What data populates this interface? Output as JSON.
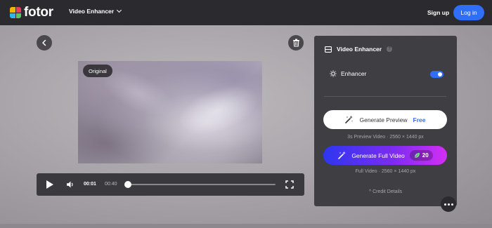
{
  "header": {
    "logo_text": "fotor",
    "product_menu_label": "Video Enhancer",
    "signup_label": "Sign up",
    "login_label": "Log in"
  },
  "player": {
    "badge": "Original",
    "current_time": "00:01",
    "total_time": "00:40",
    "progress": 0.0
  },
  "panel": {
    "title": "Video Enhancer",
    "help_glyph": "?",
    "enhancer_label": "Enhancer",
    "enhancer_on": true,
    "preview_button_label": "Generate Preview",
    "preview_price": "Free",
    "preview_info": "3s Preview Video · 2560 × 1440 px",
    "full_button_label": "Generate Full Video",
    "full_credits": "20",
    "full_info": "Full Video · 2560 × 1440 px",
    "credit_details_label": "Credit Details"
  },
  "colors": {
    "accent": "#2f6ef6",
    "panel_bg": "#3f3e42",
    "topbar_bg": "#2b2a2e",
    "gradient_start": "#2d36f0",
    "gradient_end": "#d42ef5"
  },
  "icons": [
    "back-arrow-icon",
    "trash-icon",
    "play-icon",
    "volume-icon",
    "fullscreen-icon",
    "enhance-icon",
    "sparkle-wand-icon",
    "leaf-credit-icon",
    "more-dots-icon",
    "chevron-up-icon"
  ]
}
